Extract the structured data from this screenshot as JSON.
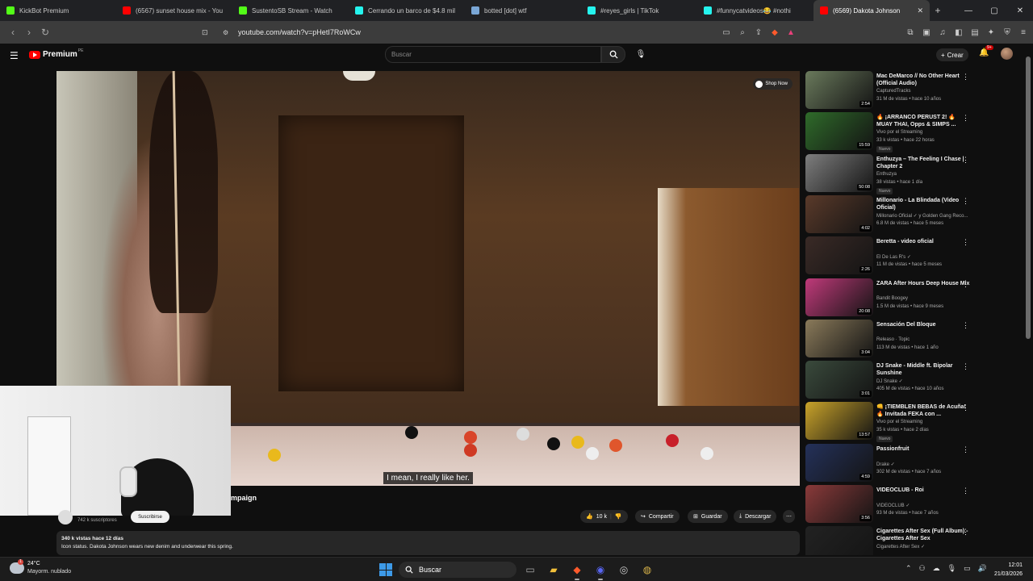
{
  "browser": {
    "tabs": [
      {
        "label": "KickBot Premium",
        "fav_color": "#53fc18",
        "fav_icon": "kick-icon"
      },
      {
        "label": "(6567) sunset house mix - You",
        "fav_color": "#ff0000",
        "fav_icon": "youtube-icon"
      },
      {
        "label": "SustentoSB Stream - Watch",
        "fav_color": "#53fc18",
        "fav_icon": "kick-icon"
      },
      {
        "label": "Cerrando un barco de $4.8 mil",
        "fav_color": "#25f4ee",
        "fav_icon": "tiktok-icon"
      },
      {
        "label": "botted [dot] wtf",
        "fav_color": "#7aa7d6",
        "fav_icon": "site-icon"
      },
      {
        "label": "#reyes_girls | TikTok",
        "fav_color": "#25f4ee",
        "fav_icon": "tiktok-icon"
      },
      {
        "label": "#funnycatvideos😂 #nothi",
        "fav_color": "#25f4ee",
        "fav_icon": "tiktok-icon"
      },
      {
        "label": "(6569) Dakota Johnson",
        "fav_color": "#ff0000",
        "fav_icon": "youtube-icon",
        "active": true
      }
    ],
    "url": "youtube.com/watch?v=pHetI7RoWCw"
  },
  "youtube": {
    "brand": "Premium",
    "region": "PE",
    "search_placeholder": "Buscar",
    "create_label": "Crear",
    "notif_count": "9+"
  },
  "video": {
    "shop_now": "Shop Now",
    "subtitle": "I mean, I really like her.",
    "title_fragment": "mpaign",
    "subscribers": "742 k suscriptores",
    "subscribe_label": "Suscribirse",
    "likes": "10 k",
    "share_label": "Compartir",
    "save_label": "Guardar",
    "download_label": "Descargar",
    "views_meta": "340 k vistas  hace 12 días",
    "description": "Icon status. Dakota Johnson wears new denim and underwear this spring."
  },
  "recommendations": [
    {
      "title": "Mac DeMarco // No Other Heart (Official Audio)",
      "channel": "CapturedTracks",
      "views": "31 M de vistas • hace 10 años",
      "duration": "2:54",
      "badge": "",
      "thumb": "#6a7a5c"
    },
    {
      "title": "🔥 ¡ARRANCÓ PERUST 2! 🔥 MUAY THAI, Opps & SIMPS ...",
      "channel": "Vivo por el Streaming",
      "views": "33 k vistas • hace 22 horas",
      "duration": "15:59",
      "badge": "Nuevo",
      "thumb": "#2f6b2a"
    },
    {
      "title": "Enthuzya – The Feeling I Chase | Chapter 2",
      "channel": "Enthuzya",
      "views": "38 vistas • hace 1 día",
      "duration": "50:08",
      "badge": "Nuevo",
      "thumb": "#7e7e7e"
    },
    {
      "title": "Millonario - La Blindada (Video Oficial)",
      "channel": "Millonario Oficial ✓ y Golden Gang Reco...",
      "views": "6.8 M de vistas • hace 5 meses",
      "duration": "4:02",
      "badge": "",
      "thumb": "#5a3a2a"
    },
    {
      "title": "Beretta - video oficial",
      "channel": "El De Las R's ✓",
      "views": "11 M de vistas • hace 5 meses",
      "duration": "2:26",
      "badge": "",
      "thumb": "#3a2a26"
    },
    {
      "title": "ZARA After Hours Deep House Mix",
      "channel": "Bandit Boogey",
      "views": "1.5 M de vistas • hace 9 meses",
      "duration": "20:08",
      "badge": "",
      "thumb": "#c03a7a"
    },
    {
      "title": "Sensación Del Bloque",
      "channel": "Releaso · Topic",
      "views": "113 M de vistas • hace 1 año",
      "duration": "3:04",
      "badge": "",
      "thumb": "#8a7a5a"
    },
    {
      "title": "DJ Snake - Middle ft. Bipolar Sunshine",
      "channel": "DJ Snake ✓",
      "views": "405 M de vistas • hace 10 años",
      "duration": "3:01",
      "badge": "",
      "thumb": "#3a4a3c"
    },
    {
      "title": "👊 ¡TIEMBLEN BEBAS de Acuña! 🔥 Invitada FEKA con ...",
      "channel": "Vivo por el Streaming",
      "views": "35 k vistas • hace 2 días",
      "duration": "13:57",
      "badge": "Nuevo",
      "thumb": "#c9a32a"
    },
    {
      "title": "Passionfruit",
      "channel": "Drake ✓",
      "views": "302 M de vistas • hace 7 años",
      "duration": "4:59",
      "badge": "",
      "thumb": "#24315a"
    },
    {
      "title": "VIDEOCLUB - Roi",
      "channel": "VIDEOCLUB ✓",
      "views": "93 M de vistas • hace 7 años",
      "duration": "3:56",
      "badge": "",
      "thumb": "#8a3a3a"
    },
    {
      "title": "Cigarettes After Sex (Full Album) - Cigarettes After Sex",
      "channel": "Cigarettes After Sex ✓",
      "views": "",
      "duration": "",
      "badge": "",
      "thumb": "#222222"
    }
  ],
  "taskbar": {
    "temperature": "24°C",
    "condition": "Mayorm. nublado",
    "weather_badge": "1",
    "search_label": "Buscar",
    "time": "12:01",
    "date": "21/03/2026"
  }
}
